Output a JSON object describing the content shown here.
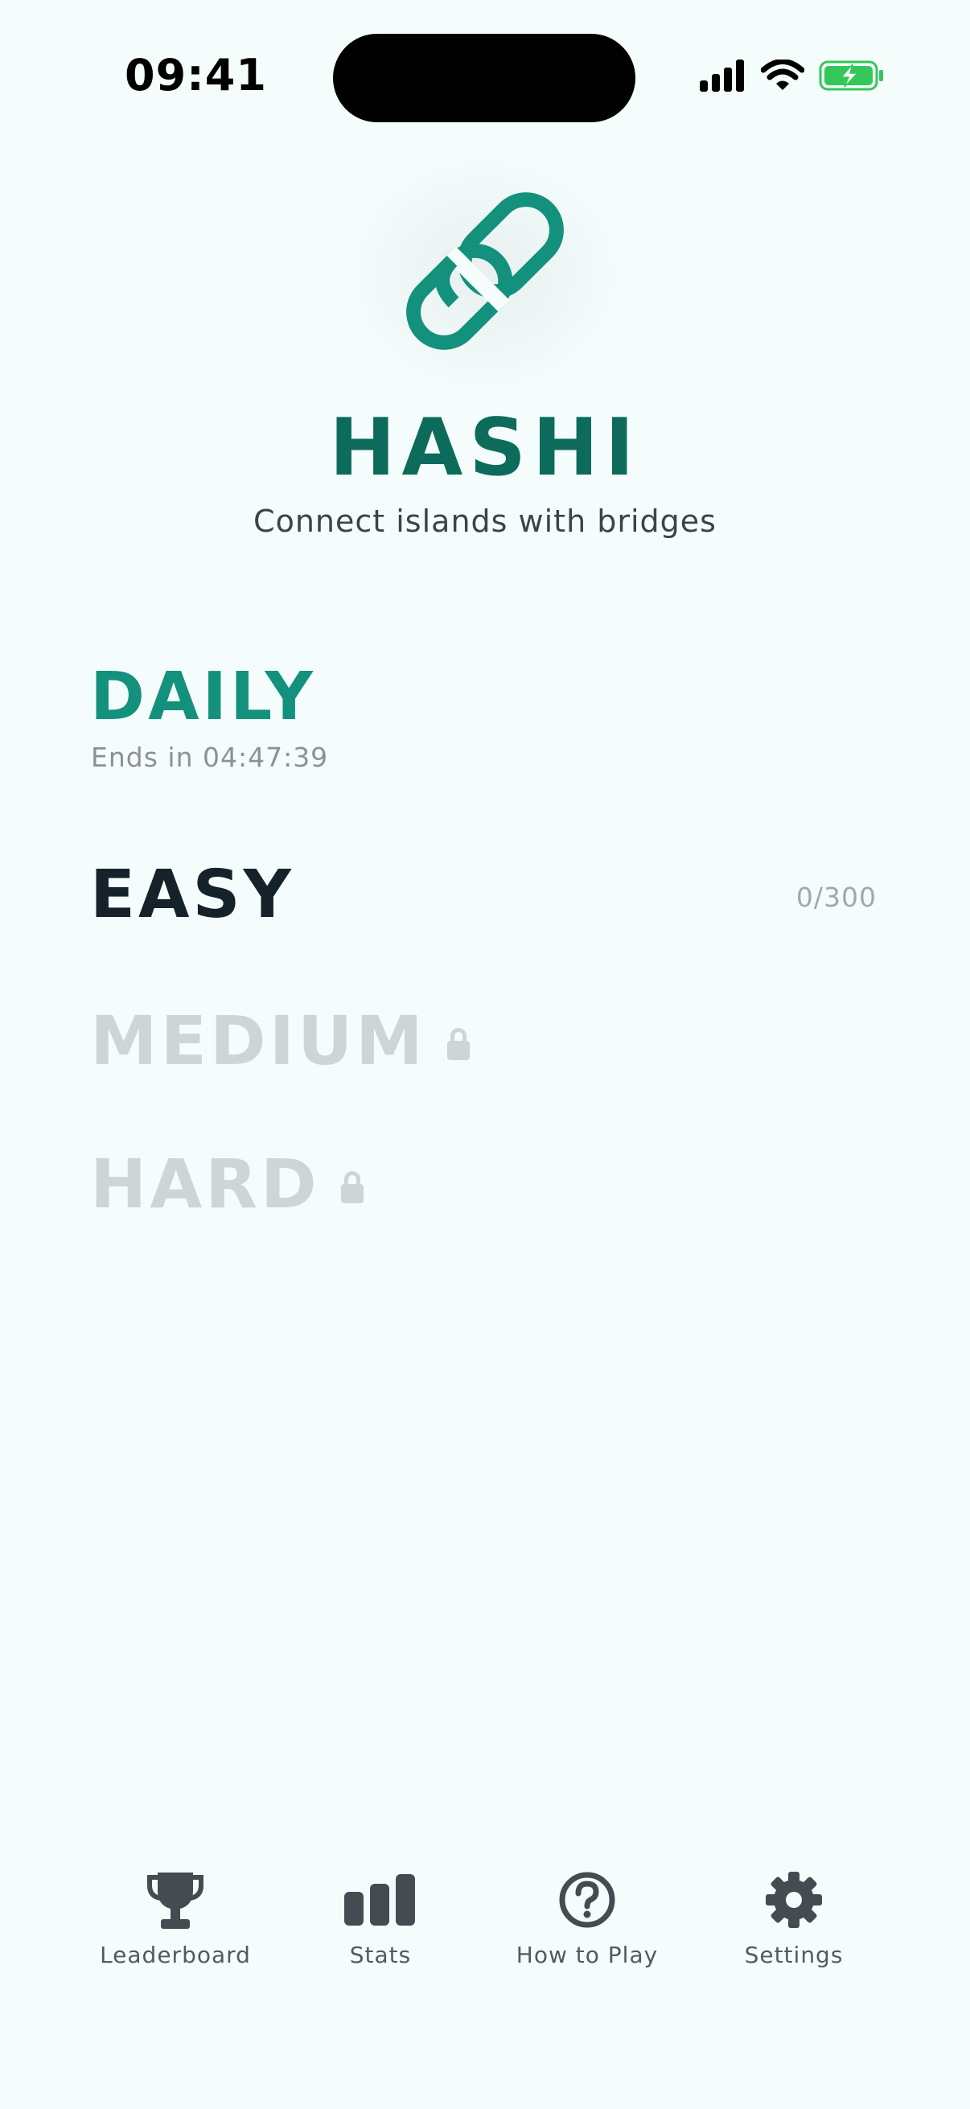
{
  "status_bar": {
    "time": "09:41",
    "icons": [
      "cellular-signal-icon",
      "wifi-icon",
      "battery-charging-icon"
    ]
  },
  "header": {
    "logo_icon": "chain-link-icon",
    "title": "HASHI",
    "subtitle": "Connect islands with bridges"
  },
  "modes": {
    "daily": {
      "label": "DAILY",
      "timer": "Ends in 04:47:39"
    },
    "easy": {
      "label": "EASY",
      "progress": "0/300"
    },
    "medium": {
      "label": "MEDIUM",
      "locked": true,
      "icon": "lock-icon"
    },
    "hard": {
      "label": "HARD",
      "locked": true,
      "icon": "lock-icon"
    }
  },
  "nav": {
    "items": [
      {
        "label": "Leaderboard",
        "icon": "trophy-icon"
      },
      {
        "label": "Stats",
        "icon": "bar-chart-icon"
      },
      {
        "label": "How to Play",
        "icon": "question-circle-icon"
      },
      {
        "label": "Settings",
        "icon": "gear-icon"
      }
    ]
  },
  "colors": {
    "background": "#f4fdfc",
    "accent": "#14917d",
    "title": "#0d6b5c",
    "locked": "#cfd5d5",
    "nav_icon": "#454c51"
  }
}
